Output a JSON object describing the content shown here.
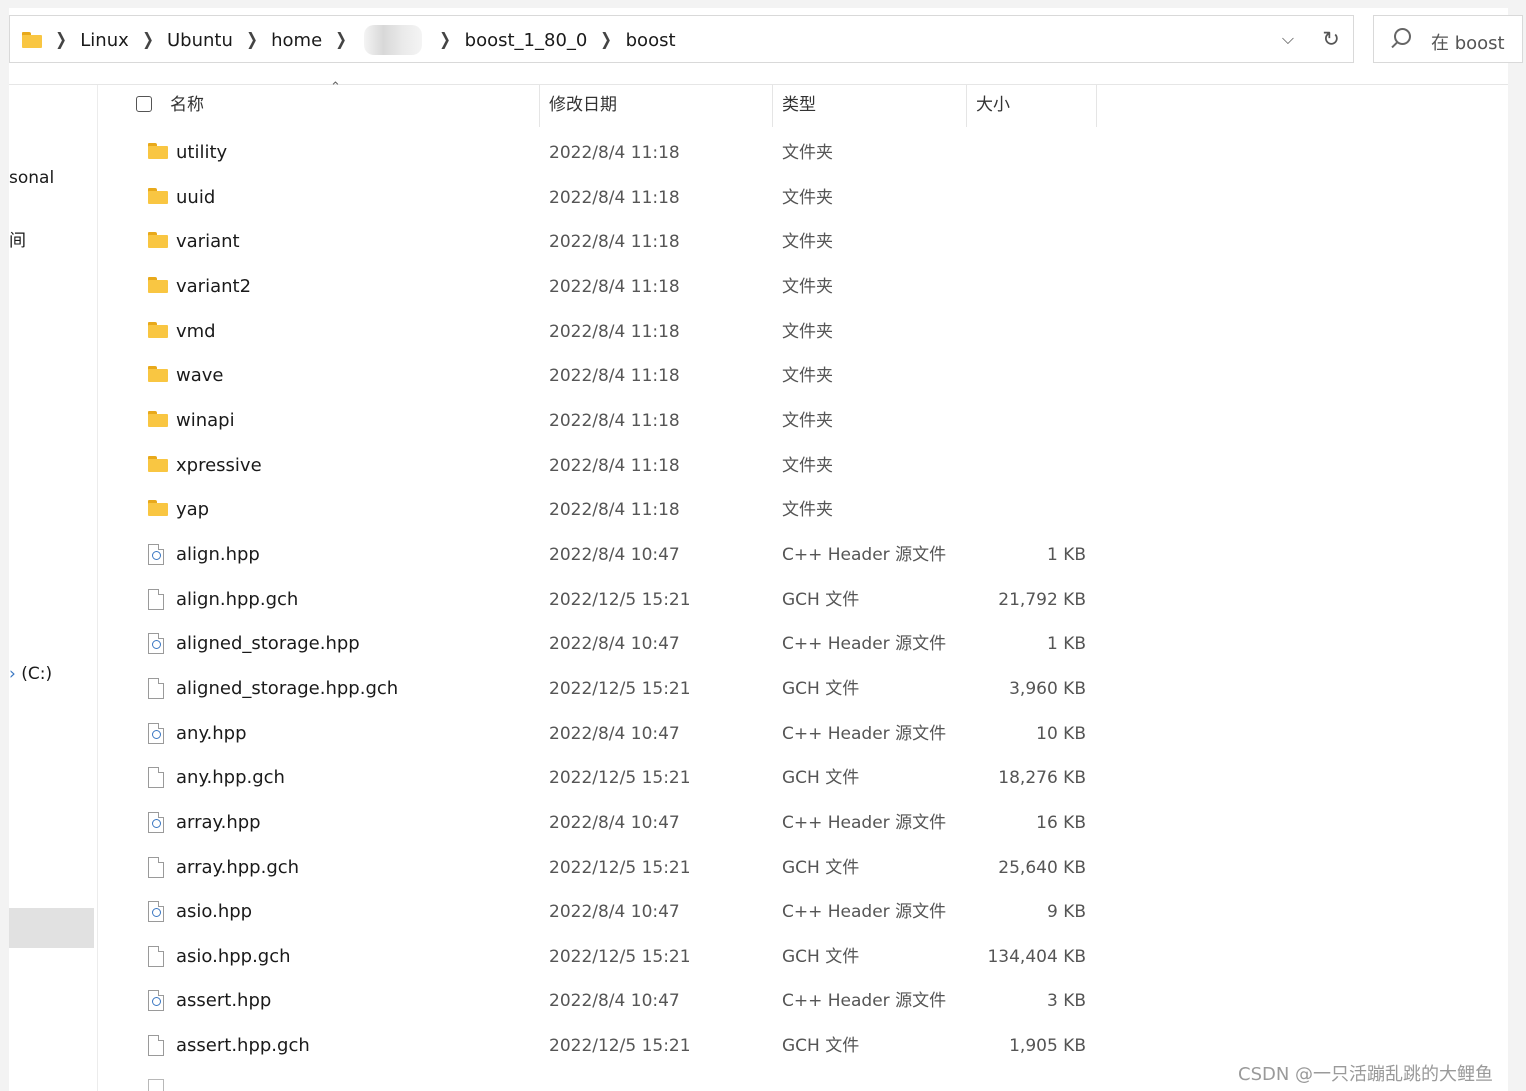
{
  "address": {
    "crumbs": [
      "Linux",
      "Ubuntu",
      "home",
      "boost_1_80_0",
      "boost"
    ],
    "dropdown_icon": "chevron-down-icon",
    "refresh_icon": "refresh-icon"
  },
  "search": {
    "placeholder": "在 boost"
  },
  "nav": {
    "items": [
      "sonal",
      "间",
      "(C:)"
    ]
  },
  "columns": {
    "name": "名称",
    "date": "修改日期",
    "type": "类型",
    "size": "大小"
  },
  "rows": [
    {
      "name": "utility",
      "date": "2022/8/4 11:18",
      "type": "文件夹",
      "size": "",
      "icon": "folder-icon"
    },
    {
      "name": "uuid",
      "date": "2022/8/4 11:18",
      "type": "文件夹",
      "size": "",
      "icon": "folder-icon"
    },
    {
      "name": "variant",
      "date": "2022/8/4 11:18",
      "type": "文件夹",
      "size": "",
      "icon": "folder-icon"
    },
    {
      "name": "variant2",
      "date": "2022/8/4 11:18",
      "type": "文件夹",
      "size": "",
      "icon": "folder-icon"
    },
    {
      "name": "vmd",
      "date": "2022/8/4 11:18",
      "type": "文件夹",
      "size": "",
      "icon": "folder-icon"
    },
    {
      "name": "wave",
      "date": "2022/8/4 11:18",
      "type": "文件夹",
      "size": "",
      "icon": "folder-icon"
    },
    {
      "name": "winapi",
      "date": "2022/8/4 11:18",
      "type": "文件夹",
      "size": "",
      "icon": "folder-icon"
    },
    {
      "name": "xpressive",
      "date": "2022/8/4 11:18",
      "type": "文件夹",
      "size": "",
      "icon": "folder-icon"
    },
    {
      "name": "yap",
      "date": "2022/8/4 11:18",
      "type": "文件夹",
      "size": "",
      "icon": "folder-icon"
    },
    {
      "name": "align.hpp",
      "date": "2022/8/4 10:47",
      "type": "C++ Header 源文件",
      "size": "1 KB",
      "icon": "cpp-header-file-icon"
    },
    {
      "name": "align.hpp.gch",
      "date": "2022/12/5 15:21",
      "type": "GCH 文件",
      "size": "21,792 KB",
      "icon": "blank-file-icon"
    },
    {
      "name": "aligned_storage.hpp",
      "date": "2022/8/4 10:47",
      "type": "C++ Header 源文件",
      "size": "1 KB",
      "icon": "cpp-header-file-icon"
    },
    {
      "name": "aligned_storage.hpp.gch",
      "date": "2022/12/5 15:21",
      "type": "GCH 文件",
      "size": "3,960 KB",
      "icon": "blank-file-icon"
    },
    {
      "name": "any.hpp",
      "date": "2022/8/4 10:47",
      "type": "C++ Header 源文件",
      "size": "10 KB",
      "icon": "cpp-header-file-icon"
    },
    {
      "name": "any.hpp.gch",
      "date": "2022/12/5 15:21",
      "type": "GCH 文件",
      "size": "18,276 KB",
      "icon": "blank-file-icon"
    },
    {
      "name": "array.hpp",
      "date": "2022/8/4 10:47",
      "type": "C++ Header 源文件",
      "size": "16 KB",
      "icon": "cpp-header-file-icon"
    },
    {
      "name": "array.hpp.gch",
      "date": "2022/12/5 15:21",
      "type": "GCH 文件",
      "size": "25,640 KB",
      "icon": "blank-file-icon"
    },
    {
      "name": "asio.hpp",
      "date": "2022/8/4 10:47",
      "type": "C++ Header 源文件",
      "size": "9 KB",
      "icon": "cpp-header-file-icon"
    },
    {
      "name": "asio.hpp.gch",
      "date": "2022/12/5 15:21",
      "type": "GCH 文件",
      "size": "134,404 KB",
      "icon": "blank-file-icon"
    },
    {
      "name": "assert.hpp",
      "date": "2022/8/4 10:47",
      "type": "C++ Header 源文件",
      "size": "3 KB",
      "icon": "cpp-header-file-icon"
    },
    {
      "name": "assert.hpp.gch",
      "date": "2022/12/5 15:21",
      "type": "GCH 文件",
      "size": "1,905 KB",
      "icon": "blank-file-icon"
    }
  ],
  "watermark": "CSDN @一只活蹦乱跳的大鲤鱼"
}
